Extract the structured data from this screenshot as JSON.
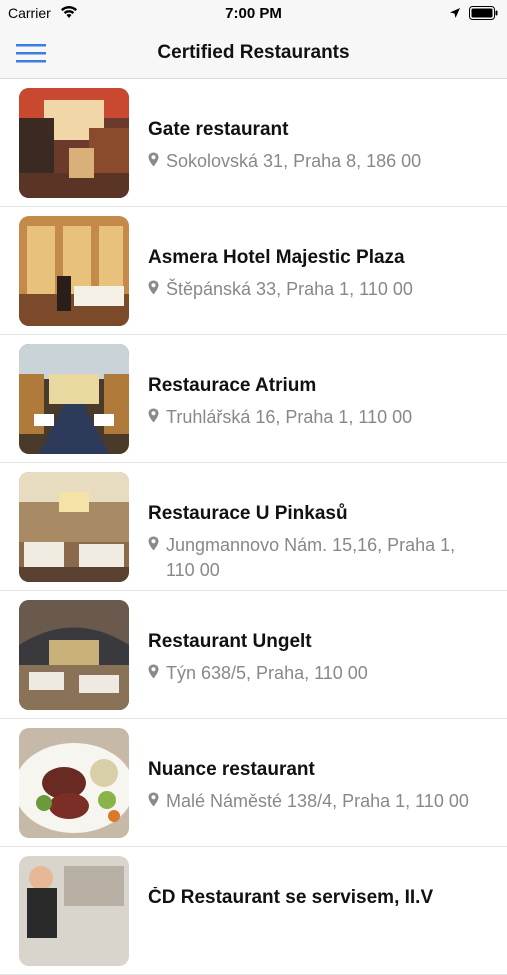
{
  "status_bar": {
    "carrier": "Carrier",
    "time": "7:00 PM"
  },
  "nav": {
    "title": "Certified Restaurants",
    "menu_icon": "hamburger-menu-icon",
    "accent": "#3a7ee4"
  },
  "restaurants": [
    {
      "name": "Gate restaurant",
      "address": "Sokolovská 31, Praha 8, 186 00"
    },
    {
      "name": "Asmera Hotel Majestic Plaza",
      "address": "Štěpánská 33, Praha 1, 110 00"
    },
    {
      "name": "Restaurace Atrium",
      "address": "Truhlářská 16, Praha 1, 110 00"
    },
    {
      "name": "Restaurace U Pinkasů",
      "address": "Jungmannovo Nám. 15,16, Praha 1, 110 00"
    },
    {
      "name": "Restaurant Ungelt",
      "address": "Týn 638/5, Praha, 110 00"
    },
    {
      "name": "Nuance restaurant",
      "address": "Malé Náměsté 138/4, Praha 1, 110 00"
    },
    {
      "name": "ČD Restaurant se servisem, II.V",
      "address": ""
    }
  ]
}
